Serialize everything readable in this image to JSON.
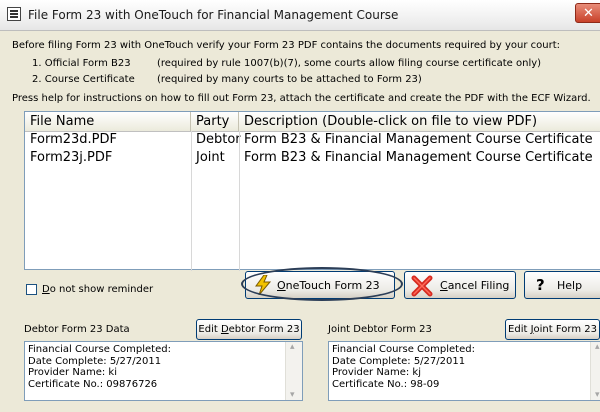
{
  "window": {
    "title": "File Form 23 with OneTouch for Financial Management Course"
  },
  "intro": {
    "line1": "Before filing Form 23 with OneTouch verify your Form 23 PDF contains the documents required by your court:",
    "item1_num": "1. Official Form B23",
    "item1_note": "(required by rule 1007(b)(7), some courts allow filing course certificate only)",
    "item2_num": "2. Course Certificate",
    "item2_note": "(required by many courts to be attached to Form 23)",
    "help_line": "Press help for instructions on how to fill out Form 23, attach the certificate and create the PDF with the ECF Wizard."
  },
  "files_table": {
    "columns": [
      "File Name",
      "Party",
      "Description        (Double-click on file to view PDF)"
    ],
    "rows": [
      {
        "file": "Form23d.PDF",
        "party": "Debtor",
        "description": "Form B23 & Financial Management Course Certificate"
      },
      {
        "file": "Form23j.PDF",
        "party": "Joint",
        "description": "Form B23 & Financial Management Course Certificate"
      }
    ]
  },
  "reminder": {
    "prefix": "D",
    "label_rest": "o not show reminder",
    "checked": false
  },
  "buttons": {
    "onetouch_prefix": "O",
    "onetouch_rest": "neTouch Form 23",
    "cancel_prefix": "C",
    "cancel_rest": "ancel Filing",
    "help": "Help"
  },
  "debtor": {
    "section_label": "Debtor Form 23 Data",
    "edit_prefix": "Edit ",
    "edit_key": "D",
    "edit_rest": "ebtor Form 23",
    "lines": [
      "Financial Course Completed:",
      "Date Complete: 5/27/2011",
      "Provider Name: ki",
      "Certificate  No.: 09876726"
    ]
  },
  "joint": {
    "section_label": "Joint Debtor Form 23",
    "edit_prefix": "Edit ",
    "edit_key": "J",
    "edit_rest": "oint Form 23",
    "lines": [
      "Financial Course Completed:",
      "Date Complete: 5/27/2011",
      "Provider Name: kj",
      "Certificate  No.: 98-09"
    ]
  },
  "colors": {
    "highlight_oval": "#2c3e57",
    "cancel_x": "#d62a20",
    "lightning": "#f2c200"
  },
  "icons": {
    "onetouch": "lightning-icon",
    "cancel": "red-x-icon",
    "help": "question-mark-icon"
  }
}
